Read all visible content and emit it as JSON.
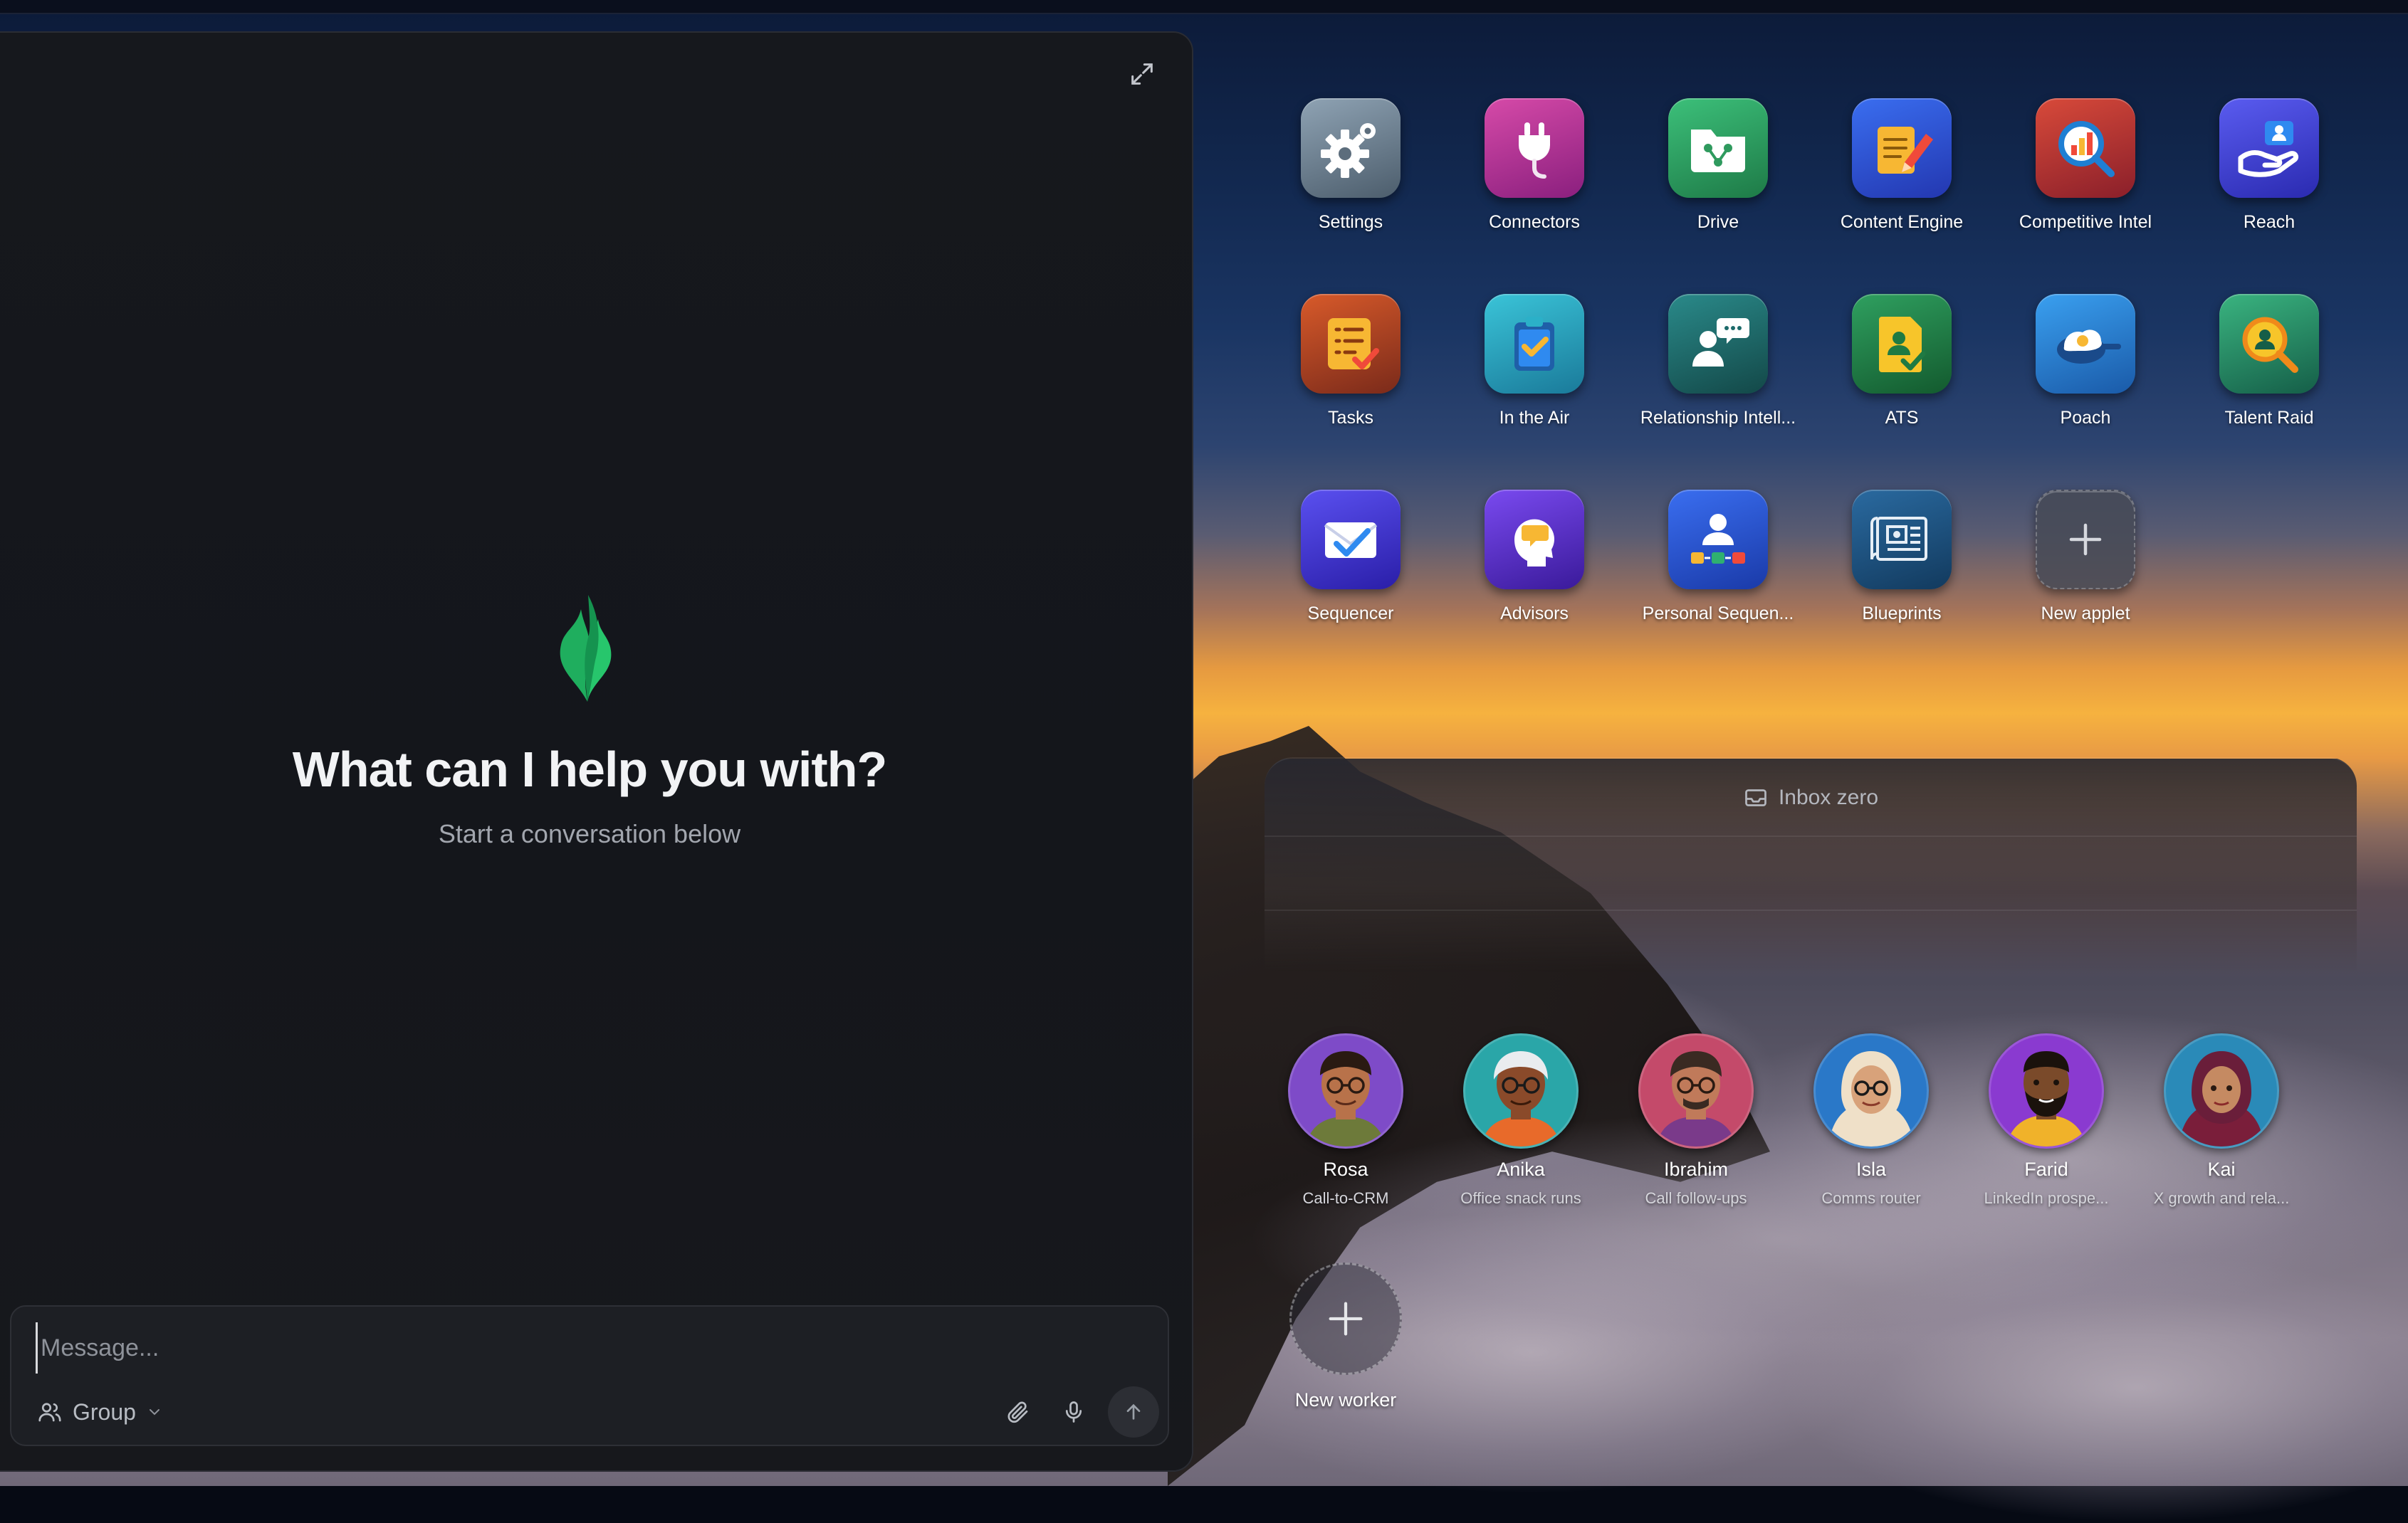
{
  "chat": {
    "title": "What can I help you with?",
    "subtitle": "Start a conversation below",
    "input_placeholder": "Message...",
    "group_label": "Group"
  },
  "applets": [
    {
      "label": "Settings",
      "icon": "gear-icon",
      "color": "#5f7080"
    },
    {
      "label": "Connectors",
      "icon": "plug-icon",
      "color": "#b02f95"
    },
    {
      "label": "Drive",
      "icon": "folder-share-icon",
      "color": "#2f9a5e"
    },
    {
      "label": "Content Engine",
      "icon": "pencil-note-icon",
      "color": "#2d57d8"
    },
    {
      "label": "Competitive Intel",
      "icon": "magnifier-chart-icon",
      "color": "#b02d34"
    },
    {
      "label": "Reach",
      "icon": "hand-contact-icon",
      "color": "#3c3fd0"
    },
    {
      "label": "Tasks",
      "icon": "checklist-icon",
      "color": "#b0452a"
    },
    {
      "label": "In the Air",
      "icon": "clipboard-check-icon",
      "color": "#1e9aae"
    },
    {
      "label": "Relationship Intell...",
      "icon": "person-chat-icon",
      "color": "#1c6a6a"
    },
    {
      "label": "ATS",
      "icon": "document-person-icon",
      "color": "#1f7a43"
    },
    {
      "label": "Poach",
      "icon": "fried-egg-pan-icon",
      "color": "#1f7fd3"
    },
    {
      "label": "Talent Raid",
      "icon": "magnifier-person-icon",
      "color": "#1f8a68"
    },
    {
      "label": "Sequencer",
      "icon": "envelope-check-icon",
      "color": "#4a3cd2"
    },
    {
      "label": "Advisors",
      "icon": "head-speech-icon",
      "color": "#5e2fb0"
    },
    {
      "label": "Personal Sequen...",
      "icon": "person-flow-icon",
      "color": "#2d52c8"
    },
    {
      "label": "Blueprints",
      "icon": "blueprint-icon",
      "color": "#1d4f7d"
    },
    {
      "label": "New applet",
      "icon": "plus-icon",
      "color": "#4b4f5c"
    }
  ],
  "inbox": {
    "label": "Inbox zero"
  },
  "workers": [
    {
      "name": "Rosa",
      "role": "Call-to-CRM",
      "bg": "#7e4bc8",
      "skin": "#b8724a",
      "hair": "#2a1a12",
      "shirt": "#6d7a3a"
    },
    {
      "name": "Anika",
      "role": "Office snack runs",
      "bg": "#2aa6a8",
      "skin": "#8a4a2a",
      "hair": "#e9ecef",
      "shirt": "#e86a2a"
    },
    {
      "name": "Ibrahim",
      "role": "Call follow-ups",
      "bg": "#c44a6a",
      "skin": "#c07a5a",
      "hair": "#3a2a22",
      "shirt": "#7a3a8a"
    },
    {
      "name": "Isla",
      "role": "Comms router",
      "bg": "#2a78c8",
      "skin": "#d8a27a",
      "hair": "#efe0c8",
      "shirt": "#efe0c8"
    },
    {
      "name": "Farid",
      "role": "LinkedIn prospe...",
      "bg": "#8a3ad0",
      "skin": "#7a4a2a",
      "hair": "#1a120c",
      "shirt": "#f0b22a"
    },
    {
      "name": "Kai",
      "role": "X growth and rela...",
      "bg": "#2a8ab8",
      "skin": "#c58a62",
      "hair": "#6a1e3a",
      "shirt": "#7a1e3a"
    }
  ],
  "new_worker": {
    "label": "New worker"
  }
}
